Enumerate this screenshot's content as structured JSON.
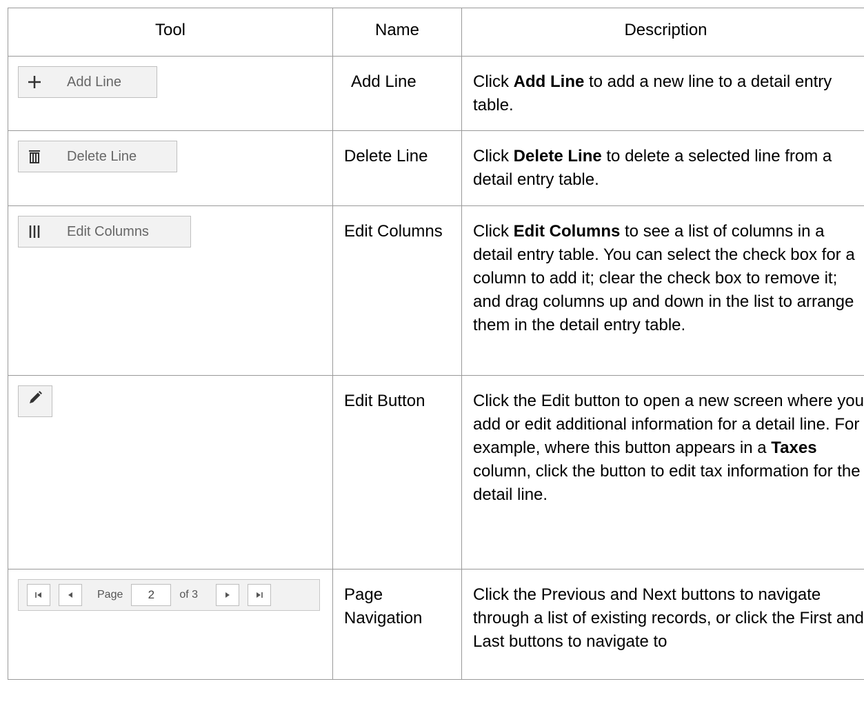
{
  "headers": {
    "tool": "Tool",
    "name": "Name",
    "description": "Description"
  },
  "rows": [
    {
      "tool_label": "Add Line",
      "icon": "plus-icon",
      "name": "Add Line",
      "desc_prefix": "Click ",
      "desc_bold": "Add Line",
      "desc_suffix": " to add a new line to a detail entry table."
    },
    {
      "tool_label": "Delete Line",
      "icon": "trash-icon",
      "name": "Delete Line",
      "desc_prefix": "Click ",
      "desc_bold": "Delete Line",
      "desc_suffix": " to delete a selected line from a detail entry table."
    },
    {
      "tool_label": "Edit Columns",
      "icon": "columns-icon",
      "name": "Edit Columns",
      "desc_prefix": "Click ",
      "desc_bold": "Edit Columns",
      "desc_suffix": " to see a list of columns in a detail entry table. You can select the check box for a column to add it; clear the check box to remove it; and drag columns up and down in the list to arrange them in the detail entry table."
    },
    {
      "icon": "pencil-icon",
      "name": "Edit Button",
      "desc_prefix": "Click the Edit button to open a new screen where you add or edit additional information for a detail line. For example, where this button appears in a ",
      "desc_bold": "Taxes",
      "desc_suffix": " column, click the button to edit tax information for the detail line."
    },
    {
      "name": "Page Navigation",
      "desc": "Click the Previous and Next buttons to navigate through a list of existing records, or click the First and Last buttons to navigate to",
      "pager": {
        "page_label": "Page",
        "page_value": "2",
        "of_label": "of 3"
      }
    }
  ]
}
